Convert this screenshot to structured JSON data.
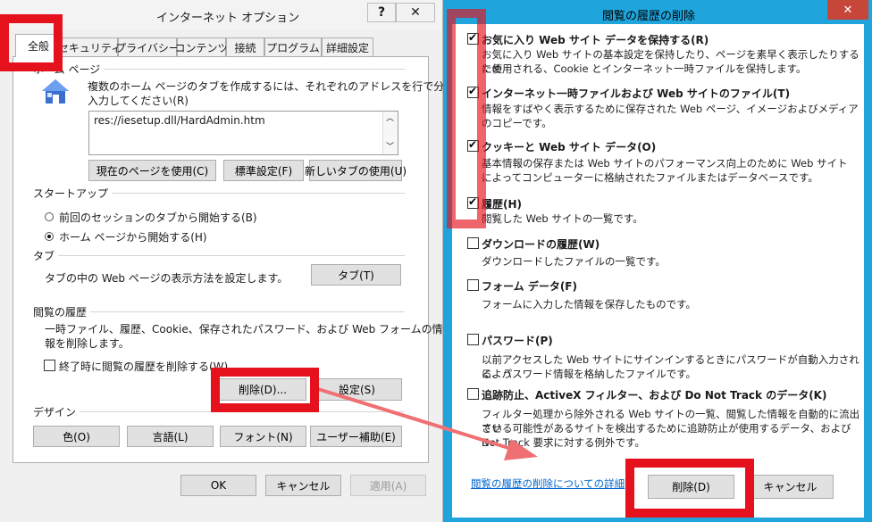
{
  "left_dialog": {
    "title": "インターネット オプション",
    "help_label": "?",
    "close_label": "✕",
    "tabs": [
      "全般",
      "セキュリティ",
      "プライバシー",
      "コンテンツ",
      "接続",
      "プログラム",
      "詳細設定"
    ],
    "home": {
      "title": "ホーム ページ",
      "description_1": "複数のホーム ページのタブを作成するには、それぞれのアドレスを行で分けて",
      "description_2": "入力してください(R)",
      "url": "res://iesetup.dll/HardAdmin.htm",
      "use_current": "現在のページを使用(C)",
      "use_default": "標準設定(F)",
      "use_new_tab": "新しいタブの使用(U)"
    },
    "startup": {
      "title": "スタートアップ",
      "option_tabs": "前回のセッションのタブから開始する(B)",
      "option_home": "ホーム ページから開始する(H)"
    },
    "tabs_group": {
      "title": "タブ",
      "description": "タブの中の Web ページの表示方法を設定します。",
      "button": "タブ(T)"
    },
    "history": {
      "title": "閲覧の履歴",
      "description_1": "一時ファイル、履歴、Cookie、保存されたパスワード、および Web フォームの情",
      "description_2": "報を削除します。",
      "checkbox": "終了時に閲覧の履歴を削除する(W)",
      "delete_button": "削除(D)...",
      "settings_button": "設定(S)"
    },
    "design": {
      "title": "デザイン",
      "colors": "色(O)",
      "languages": "言語(L)",
      "fonts": "フォント(N)",
      "accessibility": "ユーザー補助(E)"
    },
    "footer": {
      "ok": "OK",
      "cancel": "キャンセル",
      "apply": "適用(A)"
    }
  },
  "right_dialog": {
    "title": "閲覧の履歴の削除",
    "close_label": "✕",
    "options": [
      {
        "label": "お気に入り Web サイト データを保持する(R)",
        "checked": true,
        "desc_1": "お気に入り Web サイトの基本設定を保持したり、ページを素早く表示したりするため",
        "desc_2": "に使用される、Cookie とインターネット一時ファイルを保持します。"
      },
      {
        "label": "インターネット一時ファイルおよび Web サイトのファイル(T)",
        "checked": true,
        "desc_1": "情報をすばやく表示するために保存された Web ページ、イメージおよびメディア",
        "desc_2": "のコピーです。"
      },
      {
        "label": "クッキーと Web サイト データ(O)",
        "checked": true,
        "desc_1": "基本情報の保存または Web サイトのパフォーマンス向上のために Web サイト",
        "desc_2": "によってコンピューターに格納されたファイルまたはデータベースです。"
      },
      {
        "label": "履歴(H)",
        "checked": true,
        "desc_1": "閲覧した Web サイトの一覧です。",
        "desc_2": ""
      },
      {
        "label": "ダウンロードの履歴(W)",
        "checked": false,
        "desc_1": "ダウンロードしたファイルの一覧です。",
        "desc_2": ""
      },
      {
        "label": "フォーム データ(F)",
        "checked": false,
        "desc_1": "フォームに入力した情報を保存したものです。",
        "desc_2": ""
      },
      {
        "label": "パスワード(P)",
        "checked": false,
        "desc_1": "以前アクセスした Web サイトにサインインするときにパスワードが自動入力されるよう",
        "desc_2": "に、パスワード情報を格納したファイルです。"
      },
      {
        "label": "追跡防止、ActiveX フィルター、および Do Not Track のデータ(K)",
        "checked": false,
        "desc_1": "フィルター処理から除外される Web サイトの一覧、閲覧した情報を自動的に流出させ",
        "desc_2": "ている可能性があるサイトを検出するために追跡防止が使用するデータ、および Do",
        "desc_3": "Not Track 要求に対する例外です。"
      }
    ],
    "details_link": "閲覧の履歴の削除についての詳細",
    "delete_button": "削除(D)",
    "cancel_button": "キャンセル"
  },
  "colors": {
    "annotation": "#e5121d",
    "dialog_accent": "#1fa4dc",
    "link": "#0066cc"
  }
}
